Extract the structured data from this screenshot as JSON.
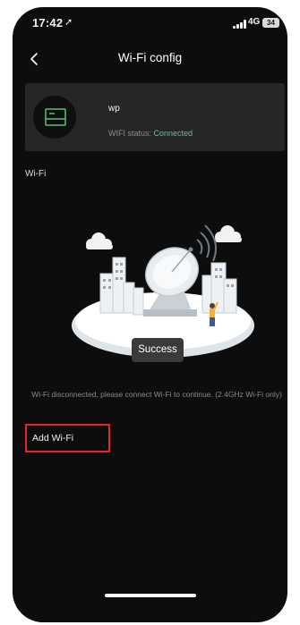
{
  "status_bar": {
    "time": "17:42",
    "network": "4G",
    "battery": "34"
  },
  "header": {
    "title": "Wi-Fi config"
  },
  "device": {
    "name": "wp",
    "status_label": "WIFI status: ",
    "status_value": "Connected"
  },
  "wifi_section": {
    "label": "Wi-Fi"
  },
  "toast": {
    "message": "Success"
  },
  "hint": {
    "text": "Wi-Fi disconnected, please connect Wi-Fi to continue. (2.4GHz Wi-Fi only)"
  },
  "actions": {
    "add_wifi_label": "Add Wi-Fi"
  },
  "colors": {
    "background": "#0d0d0d",
    "card": "#262626",
    "success_green": "#63c38b",
    "highlight_red": "#e8232a"
  },
  "icons": [
    "location-arrow-icon",
    "signal-icon",
    "battery-icon",
    "back-chevron-icon",
    "device-router-icon",
    "satellite-dish-illustration"
  ]
}
